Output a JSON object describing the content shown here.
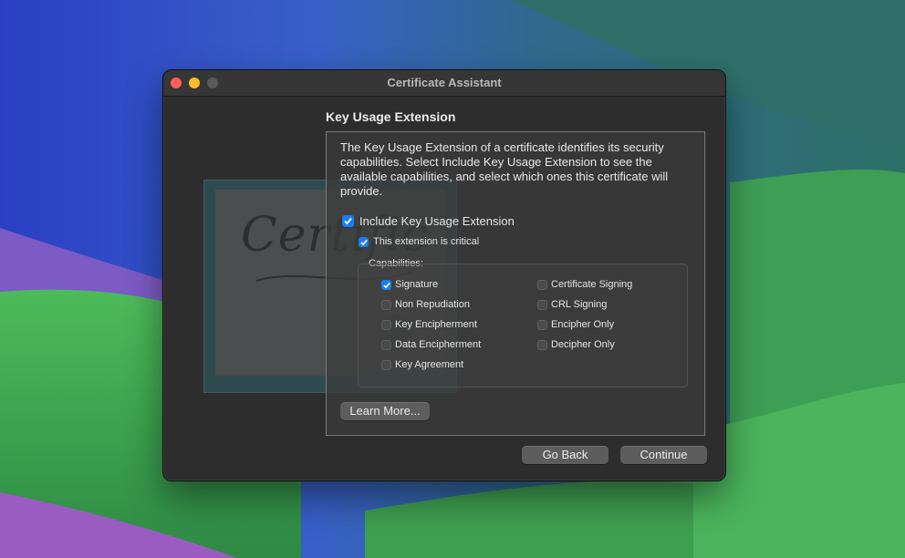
{
  "window": {
    "title": "Certificate Assistant"
  },
  "page": {
    "heading": "Key Usage Extension",
    "description": "The Key Usage Extension of a certificate identifies its security capabilities. Select Include Key Usage Extension to see the available capabilities, and select which ones this certificate will provide.",
    "include_label": "Include Key Usage Extension",
    "include_checked": true,
    "critical_label": "This extension is critical",
    "critical_checked": true,
    "capabilities_label": "Capabilities:",
    "capabilities_left": [
      {
        "label": "Signature",
        "checked": true
      },
      {
        "label": "Non Repudiation",
        "checked": false
      },
      {
        "label": "Key Encipherment",
        "checked": false
      },
      {
        "label": "Data Encipherment",
        "checked": false
      },
      {
        "label": "Key Agreement",
        "checked": false
      }
    ],
    "capabilities_right": [
      {
        "label": "Certificate Signing",
        "checked": false
      },
      {
        "label": "CRL Signing",
        "checked": false
      },
      {
        "label": "Encipher Only",
        "checked": false
      },
      {
        "label": "Decipher Only",
        "checked": false
      }
    ],
    "learn_more_label": "Learn More..."
  },
  "buttons": {
    "back_label": "Go Back",
    "continue_label": "Continue"
  },
  "illustration": {
    "text": "Certific"
  },
  "colors": {
    "accent": "#1a7ef2",
    "close": "#fe5f57",
    "minimize": "#febc2e"
  }
}
